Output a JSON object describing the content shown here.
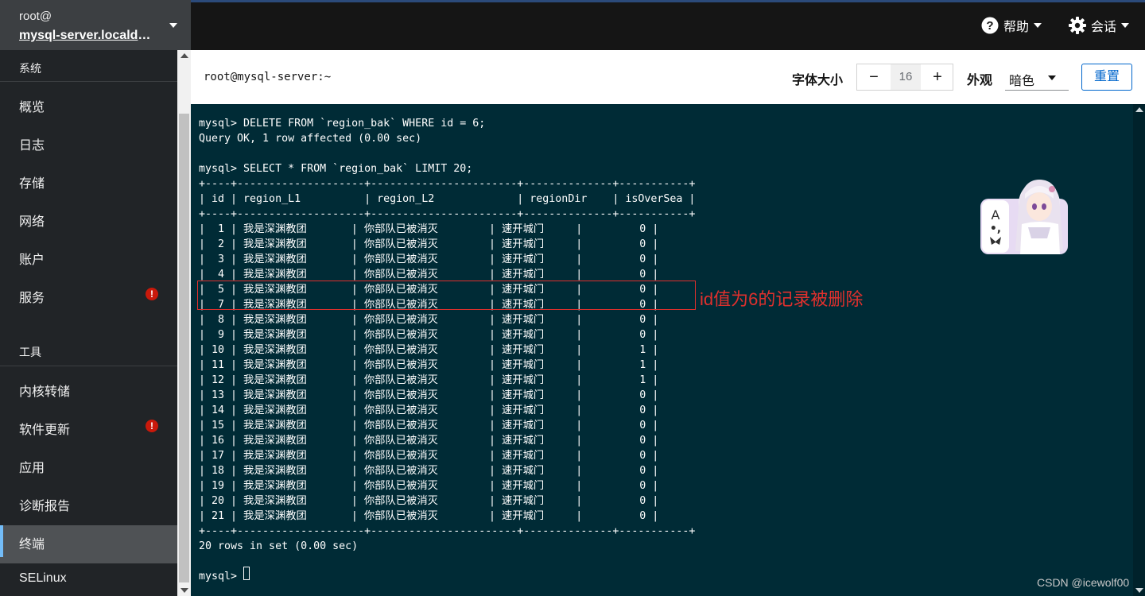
{
  "host": {
    "user": "root@",
    "name": "mysql-server.localdomain"
  },
  "sidebar": {
    "header_system": "系统",
    "header_tools": "工具",
    "items": [
      {
        "label": "概览"
      },
      {
        "label": "日志"
      },
      {
        "label": "存储"
      },
      {
        "label": "网络"
      },
      {
        "label": "账户"
      },
      {
        "label": "服务",
        "alert": "!"
      },
      {
        "label": "内核转储"
      },
      {
        "label": "软件更新",
        "alert": "!"
      },
      {
        "label": "应用"
      },
      {
        "label": "诊断报告"
      },
      {
        "label": "终端"
      },
      {
        "label": "SELinux"
      }
    ]
  },
  "topbar": {
    "help": "帮助",
    "session": "会话"
  },
  "toolbar": {
    "title": "root@mysql-server:~",
    "font_size_label": "字体大小",
    "font_size_minus": "−",
    "font_size_value": "16",
    "font_size_plus": "+",
    "appearance_label": "外观",
    "appearance_value": "暗色",
    "reset_label": "重置"
  },
  "terminal": {
    "lines": [
      "mysql> DELETE FROM `region_bak` WHERE id = 6;",
      "Query OK, 1 row affected (0.00 sec)",
      "",
      "mysql> SELECT * FROM `region_bak` LIMIT 20;",
      "+----+--------------------+-----------------------+--------------+-----------+",
      "| id | region_L1          | region_L2             | regionDir    | isOverSea |",
      "+----+--------------------+-----------------------+--------------+-----------+",
      "|  1 | 我是深渊教团       | 你部队已被消灭        | 速开城门     |         0 |",
      "|  2 | 我是深渊教团       | 你部队已被消灭        | 速开城门     |         0 |",
      "|  3 | 我是深渊教团       | 你部队已被消灭        | 速开城门     |         0 |",
      "|  4 | 我是深渊教团       | 你部队已被消灭        | 速开城门     |         0 |",
      "|  5 | 我是深渊教团       | 你部队已被消灭        | 速开城门     |         0 |",
      "|  7 | 我是深渊教团       | 你部队已被消灭        | 速开城门     |         0 |",
      "|  8 | 我是深渊教团       | 你部队已被消灭        | 速开城门     |         0 |",
      "|  9 | 我是深渊教团       | 你部队已被消灭        | 速开城门     |         0 |",
      "| 10 | 我是深渊教团       | 你部队已被消灭        | 速开城门     |         1 |",
      "| 11 | 我是深渊教团       | 你部队已被消灭        | 速开城门     |         1 |",
      "| 12 | 我是深渊教团       | 你部队已被消灭        | 速开城门     |         1 |",
      "| 13 | 我是深渊教团       | 你部队已被消灭        | 速开城门     |         0 |",
      "| 14 | 我是深渊教团       | 你部队已被消灭        | 速开城门     |         0 |",
      "| 15 | 我是深渊教团       | 你部队已被消灭        | 速开城门     |         0 |",
      "| 16 | 我是深渊教团       | 你部队已被消灭        | 速开城门     |         0 |",
      "| 17 | 我是深渊教团       | 你部队已被消灭        | 速开城门     |         0 |",
      "| 18 | 我是深渊教团       | 你部队已被消灭        | 速开城门     |         0 |",
      "| 19 | 我是深渊教团       | 你部队已被消灭        | 速开城门     |         0 |",
      "| 20 | 我是深渊教团       | 你部队已被消灭        | 速开城门     |         0 |",
      "| 21 | 我是深渊教团       | 你部队已被消灭        | 速开城门     |         0 |",
      "+----+--------------------+-----------------------+--------------+-----------+",
      "20 rows in set (0.00 sec)",
      "",
      "mysql> "
    ]
  },
  "annotation": "id值为6的记录被删除",
  "widget_letter": "A",
  "watermark": "CSDN @icewolf00",
  "colors": {
    "sidebar_bg": "#212427",
    "terminal_bg": "#002b36",
    "annotation": "#e0302d",
    "link": "#0066cc",
    "alert": "#c9190b"
  }
}
